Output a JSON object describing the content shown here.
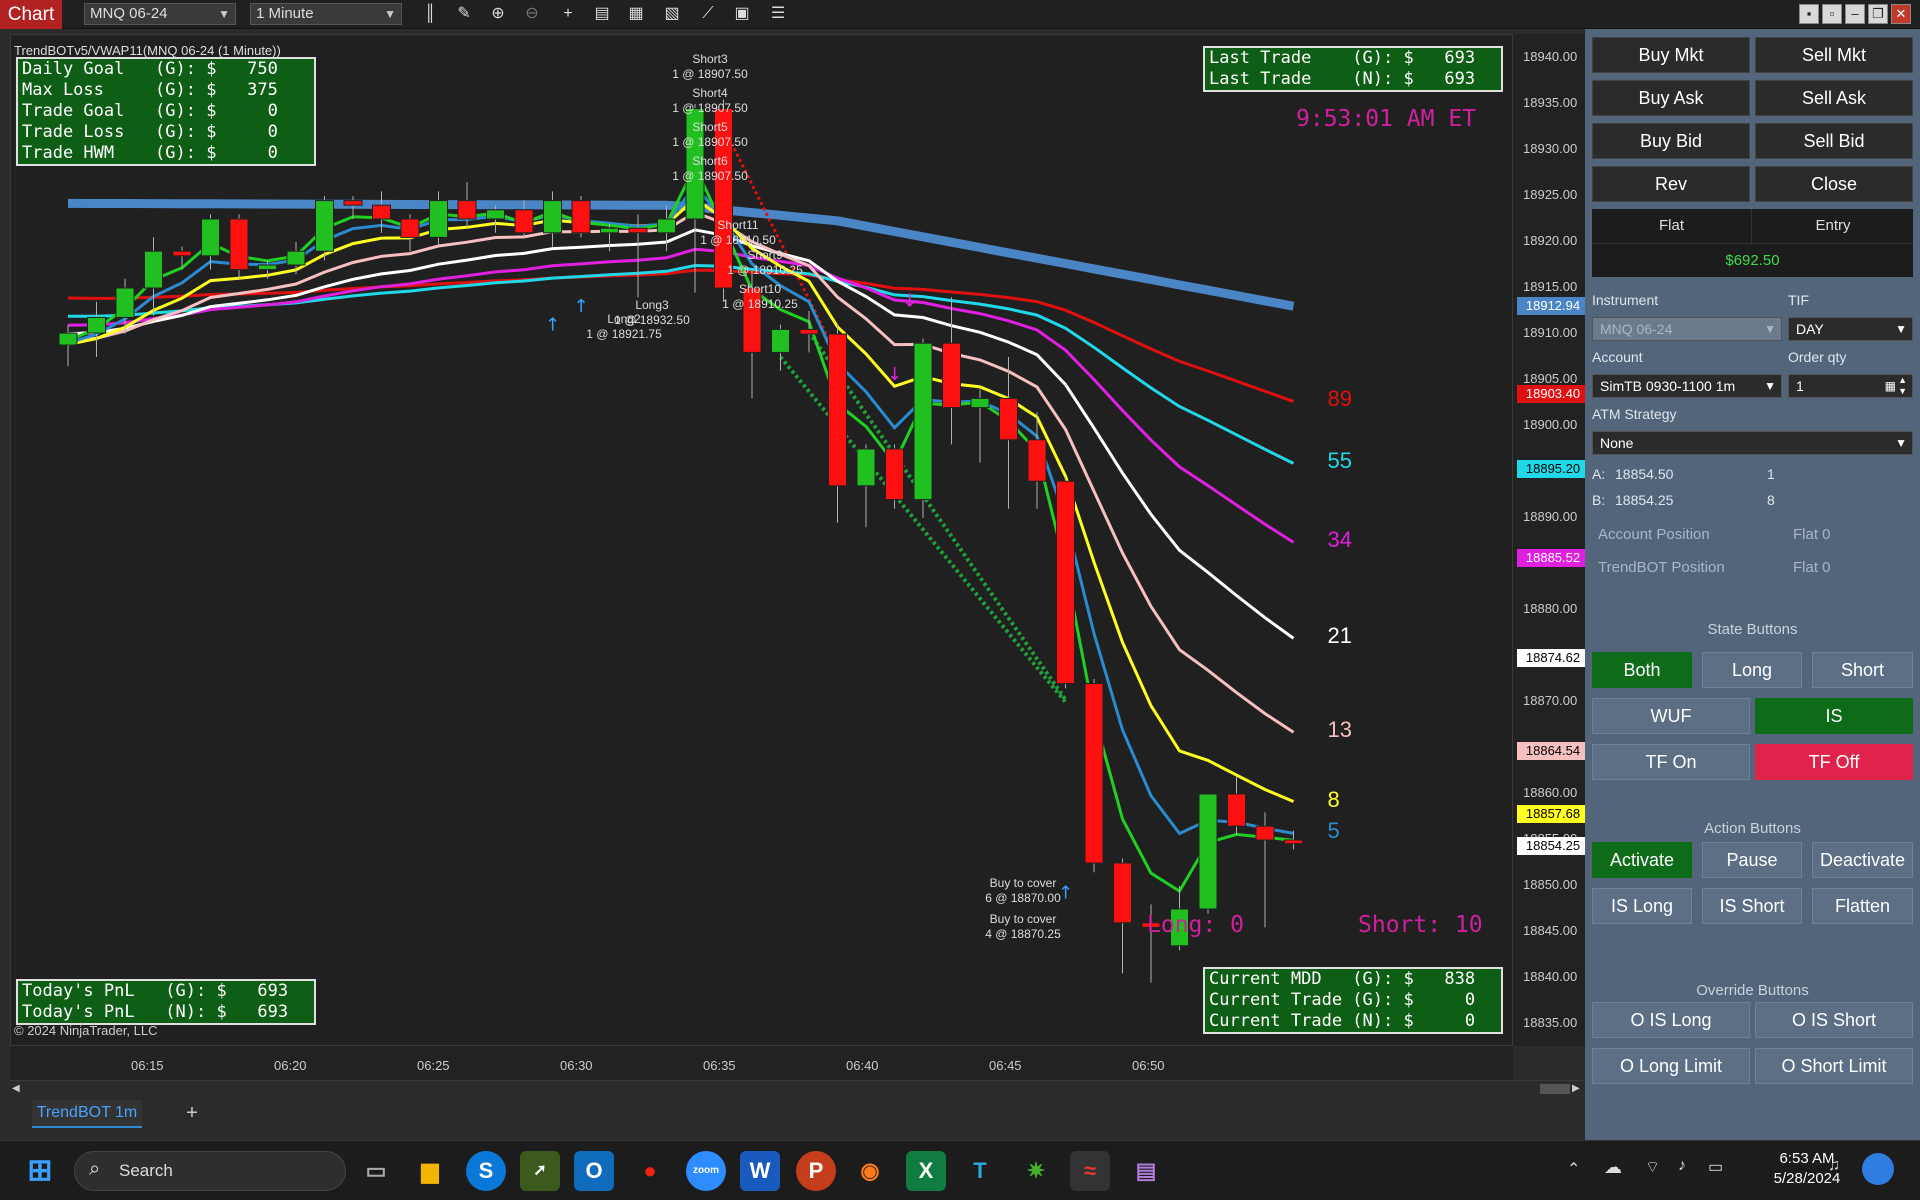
{
  "window": {
    "chart_label": "Chart",
    "instrument_select": "MNQ 06-24",
    "interval_select": "1 Minute"
  },
  "chart": {
    "title_line": "TrendBOTv5/VWAP11(MNQ 06-24 (1 Minute))",
    "copyright": "© 2024 NinjaTrader, LLC",
    "clock": "9:53:01 AM ET",
    "long_count": "Long:  0",
    "short_count": "Short: 10",
    "top_left_box": [
      "Daily Goal   (G): $   750",
      "Max Loss     (G): $   375",
      "Trade Goal   (G): $     0",
      "Trade Loss   (G): $     0",
      "Trade HWM    (G): $     0"
    ],
    "top_right_box": [
      "Last Trade    (G): $   693",
      "Last Trade    (N): $   693"
    ],
    "bottom_left_box": [
      "Today's PnL   (G): $   693",
      "Today's PnL   (N): $   693"
    ],
    "bottom_right_box": [
      "Current MDD   (G): $   838",
      "Current Trade (G): $     0",
      "Current Trade (N): $     0"
    ],
    "price_ticks": [
      "18940.00",
      "18935.00",
      "18930.00",
      "18925.00",
      "18920.00",
      "18915.00",
      "18910.00",
      "18905.00",
      "18900.00",
      "18895.00",
      "18890.00",
      "18885.00",
      "18880.00",
      "18875.00",
      "18870.00",
      "18865.00",
      "18860.00",
      "18855.00",
      "18850.00",
      "18845.00",
      "18840.00",
      "18835.00"
    ],
    "price_badges": [
      {
        "text": "18912.94",
        "bg": "#4a86c5",
        "fg": "#ffffff",
        "price": 18912.94
      },
      {
        "text": "18903.40",
        "bg": "#e01010",
        "fg": "#ffffff",
        "price": 18903.4
      },
      {
        "text": "18895.20",
        "bg": "#20d8e8",
        "fg": "#000000",
        "price": 18895.2
      },
      {
        "text": "18885.52",
        "bg": "#e020e0",
        "fg": "#ffffff",
        "price": 18885.52
      },
      {
        "text": "18874.62",
        "bg": "#ffffff",
        "fg": "#000000",
        "price": 18874.62
      },
      {
        "text": "18864.54",
        "bg": "#f6c0c0",
        "fg": "#000000",
        "price": 18864.54
      },
      {
        "text": "18857.68",
        "bg": "#ffff20",
        "fg": "#000000",
        "price": 18857.68
      },
      {
        "text": "18854.25",
        "bg": "#ffffff",
        "fg": "#000000",
        "price": 18854.25
      }
    ],
    "time_ticks": [
      "06:15",
      "06:20",
      "06:25",
      "06:30",
      "06:35",
      "06:40",
      "06:45",
      "06:50"
    ],
    "ema_labels": [
      {
        "text": "89",
        "color": "#e01010"
      },
      {
        "text": "55",
        "color": "#20d8e8"
      },
      {
        "text": "34",
        "color": "#e020e0"
      },
      {
        "text": "21",
        "color": "#ffffff"
      },
      {
        "text": "13",
        "color": "#f6c0c0"
      },
      {
        "text": "8",
        "color": "#ffff20"
      },
      {
        "text": "5",
        "color": "#2a8bd0"
      }
    ],
    "trade_labels": [
      {
        "text": "Short3\n1 @ 18907.50"
      },
      {
        "text": "Short4\n1 @ 18907.50"
      },
      {
        "text": "Short5\n1 @ 18907.50"
      },
      {
        "text": "Short6\n1 @ 18907.50"
      },
      {
        "text": "Short11\n1 @ 18910.50"
      },
      {
        "text": "Short9\n1 @ 18910.25"
      },
      {
        "text": "Short10\n1 @ 18910.25"
      },
      {
        "text": "Long3\n1 @ 18932.50"
      },
      {
        "text": "Long2\n1 @ 18921.75"
      },
      {
        "text": "Buy to cover\n6 @ 18870.00"
      },
      {
        "text": "Buy to cover\n4 @ 18870.25"
      }
    ],
    "candles": [
      {
        "o": 18908.8,
        "h": 18911.0,
        "l": 18906.5,
        "c": 18910.1
      },
      {
        "o": 18910.1,
        "h": 18913.5,
        "l": 18907.5,
        "c": 18911.8
      },
      {
        "o": 18911.8,
        "h": 18916.0,
        "l": 18910.0,
        "c": 18915.0
      },
      {
        "o": 18915.0,
        "h": 18920.5,
        "l": 18912.0,
        "c": 18919.0
      },
      {
        "o": 18919.0,
        "h": 18919.5,
        "l": 18917.0,
        "c": 18918.5
      },
      {
        "o": 18918.5,
        "h": 18923.0,
        "l": 18917.0,
        "c": 18922.5
      },
      {
        "o": 18922.5,
        "h": 18923.0,
        "l": 18916.0,
        "c": 18917.0
      },
      {
        "o": 18917.0,
        "h": 18918.0,
        "l": 18916.0,
        "c": 18917.5
      },
      {
        "o": 18917.5,
        "h": 18920.0,
        "l": 18916.5,
        "c": 18919.0
      },
      {
        "o": 18919.0,
        "h": 18925.0,
        "l": 18918.0,
        "c": 18924.5
      },
      {
        "o": 18924.5,
        "h": 18925.0,
        "l": 18922.5,
        "c": 18924.0
      },
      {
        "o": 18924.0,
        "h": 18925.5,
        "l": 18921.0,
        "c": 18922.5
      },
      {
        "o": 18922.5,
        "h": 18923.0,
        "l": 18919.0,
        "c": 18920.5
      },
      {
        "o": 18920.5,
        "h": 18925.5,
        "l": 18919.5,
        "c": 18924.5
      },
      {
        "o": 18924.5,
        "h": 18926.5,
        "l": 18921.5,
        "c": 18922.5
      },
      {
        "o": 18922.5,
        "h": 18924.0,
        "l": 18921.0,
        "c": 18923.5
      },
      {
        "o": 18923.5,
        "h": 18924.5,
        "l": 18920.5,
        "c": 18921.0
      },
      {
        "o": 18921.0,
        "h": 18925.5,
        "l": 18919.5,
        "c": 18924.5
      },
      {
        "o": 18924.5,
        "h": 18925.0,
        "l": 18920.5,
        "c": 18921.0
      },
      {
        "o": 18921.0,
        "h": 18922.0,
        "l": 18919.0,
        "c": 18921.5
      },
      {
        "o": 18921.5,
        "h": 18923.0,
        "l": 18914.0,
        "c": 18921.0
      },
      {
        "o": 18921.0,
        "h": 18924.0,
        "l": 18919.0,
        "c": 18922.5
      },
      {
        "o": 18922.5,
        "h": 18935.0,
        "l": 18914.5,
        "c": 18934.5
      },
      {
        "o": 18934.5,
        "h": 18935.5,
        "l": 18913.5,
        "c": 18915.0
      },
      {
        "o": 18915.0,
        "h": 18917.0,
        "l": 18903.0,
        "c": 18908.0
      },
      {
        "o": 18908.0,
        "h": 18911.0,
        "l": 18906.0,
        "c": 18910.5
      },
      {
        "o": 18910.5,
        "h": 18912.5,
        "l": 18908.0,
        "c": 18910.0
      },
      {
        "o": 18910.0,
        "h": 18911.0,
        "l": 18889.5,
        "c": 18893.5
      },
      {
        "o": 18893.5,
        "h": 18898.0,
        "l": 18889.0,
        "c": 18897.5
      },
      {
        "o": 18897.5,
        "h": 18898.0,
        "l": 18891.0,
        "c": 18892.0
      },
      {
        "o": 18892.0,
        "h": 18909.5,
        "l": 18890.0,
        "c": 18909.0
      },
      {
        "o": 18909.0,
        "h": 18914.0,
        "l": 18898.0,
        "c": 18902.0
      },
      {
        "o": 18902.0,
        "h": 18904.0,
        "l": 18896.0,
        "c": 18903.0
      },
      {
        "o": 18903.0,
        "h": 18907.5,
        "l": 18891.0,
        "c": 18898.5
      },
      {
        "o": 18898.5,
        "h": 18901.5,
        "l": 18891.0,
        "c": 18894.0
      },
      {
        "o": 18894.0,
        "h": 18894.5,
        "l": 18871.5,
        "c": 18872.0
      },
      {
        "o": 18872.0,
        "h": 18872.5,
        "l": 18851.5,
        "c": 18852.5
      },
      {
        "o": 18852.5,
        "h": 18853.0,
        "l": 18840.5,
        "c": 18846.0
      },
      {
        "o": 18846.0,
        "h": 18848.0,
        "l": 18839.5,
        "c": 18845.5
      },
      {
        "o": 18843.5,
        "h": 18850.0,
        "l": 18843.0,
        "c": 18847.5
      },
      {
        "o": 18847.5,
        "h": 18859.0,
        "l": 18847.0,
        "c": 18860.0
      },
      {
        "o": 18860.0,
        "h": 18862.0,
        "l": 18855.5,
        "c": 18856.5
      },
      {
        "o": 18856.5,
        "h": 18858.0,
        "l": 18845.5,
        "c": 18855.0
      },
      {
        "o": 18855.0,
        "h": 18856.0,
        "l": 18854.0,
        "c": 18854.6
      }
    ]
  },
  "panel": {
    "buttons_top": [
      "Buy Mkt",
      "Sell Mkt",
      "Buy Ask",
      "Sell Ask",
      "Buy Bid",
      "Sell Bid",
      "Rev",
      "Close"
    ],
    "position_state": "Flat",
    "entry_label": "Entry",
    "pnl": "$692.50",
    "instrument_label": "Instrument",
    "instrument_value": "MNQ 06-24",
    "tif_label": "TIF",
    "tif_value": "DAY",
    "account_label": "Account",
    "account_value": "SimTB 0930-1100 1m",
    "order_qty_label": "Order qty",
    "order_qty_value": "1",
    "atm_label": "ATM Strategy",
    "atm_value": "None",
    "ask_label": "A:",
    "ask_price": "18854.50",
    "ask_size": "1",
    "bid_label": "B:",
    "bid_price": "18854.25",
    "bid_size": "8",
    "account_position_label": "Account Position",
    "account_position_value": "Flat  0",
    "trendbot_position_label": "TrendBOT Position",
    "trendbot_position_value": "Flat  0",
    "state_title": "State Buttons",
    "state_buttons": [
      "Both",
      "Long",
      "Short",
      "WUF",
      "IS",
      "TF On",
      "TF Off"
    ],
    "action_title": "Action Buttons",
    "action_buttons": [
      "Activate",
      "Pause",
      "Deactivate",
      "IS Long",
      "IS Short",
      "Flatten"
    ],
    "override_title": "Override Buttons",
    "override_buttons": [
      "O IS Long",
      "O IS Short",
      "O Long Limit",
      "O Short Limit"
    ]
  },
  "tabs": {
    "active": "TrendBOT 1m",
    "add": "+"
  },
  "taskbar": {
    "search_placeholder": "Search",
    "time": "6:53 AM",
    "date": "5/28/2024"
  }
}
